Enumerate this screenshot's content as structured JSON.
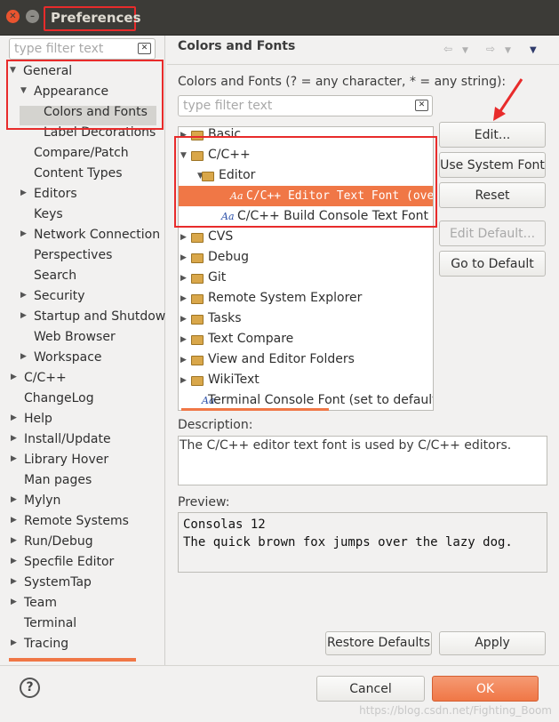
{
  "window": {
    "title": "Preferences",
    "close_glyph": "✕",
    "min_glyph": "–"
  },
  "left": {
    "filter_placeholder": "type filter text",
    "tree": [
      {
        "label": "General",
        "expanded": true
      },
      {
        "label": "Appearance",
        "expanded": true
      },
      {
        "label": "Colors and Fonts",
        "selected": true
      },
      {
        "label": "Label Decorations"
      },
      {
        "label": "Compare/Patch"
      },
      {
        "label": "Content Types"
      },
      {
        "label": "Editors",
        "expandable": true
      },
      {
        "label": "Keys"
      },
      {
        "label": "Network Connection",
        "expandable": true
      },
      {
        "label": "Perspectives"
      },
      {
        "label": "Search"
      },
      {
        "label": "Security",
        "expandable": true
      },
      {
        "label": "Startup and Shutdow",
        "expandable": true
      },
      {
        "label": "Web Browser"
      },
      {
        "label": "Workspace",
        "expandable": true
      },
      {
        "label": "C/C++",
        "expandable": true
      },
      {
        "label": "ChangeLog"
      },
      {
        "label": "Help",
        "expandable": true
      },
      {
        "label": "Install/Update",
        "expandable": true
      },
      {
        "label": "Library Hover",
        "expandable": true
      },
      {
        "label": "Man pages"
      },
      {
        "label": "Mylyn",
        "expandable": true
      },
      {
        "label": "Remote Systems",
        "expandable": true
      },
      {
        "label": "Run/Debug",
        "expandable": true
      },
      {
        "label": "Specfile Editor",
        "expandable": true
      },
      {
        "label": "SystemTap",
        "expandable": true
      },
      {
        "label": "Team",
        "expandable": true
      },
      {
        "label": "Terminal"
      },
      {
        "label": "Tracing",
        "expandable": true
      }
    ]
  },
  "right": {
    "title": "Colors and Fonts",
    "instructions": "Colors and Fonts (? = any character, * = any string):",
    "filter_placeholder": "type filter text",
    "tree": [
      {
        "label": "Basic",
        "kind": "folder"
      },
      {
        "label": "C/C++",
        "kind": "folder",
        "expanded": true
      },
      {
        "label": "Editor",
        "kind": "folder",
        "expanded": true
      },
      {
        "label": "C/C++ Editor Text Font (overr",
        "kind": "font",
        "selected": true
      },
      {
        "label": "C/C++ Build Console Text Font (set to",
        "kind": "font"
      },
      {
        "label": "CVS",
        "kind": "folder"
      },
      {
        "label": "Debug",
        "kind": "folder"
      },
      {
        "label": "Git",
        "kind": "folder"
      },
      {
        "label": "Remote System Explorer",
        "kind": "folder"
      },
      {
        "label": "Tasks",
        "kind": "folder"
      },
      {
        "label": "Text Compare",
        "kind": "folder"
      },
      {
        "label": "View and Editor Folders",
        "kind": "folder"
      },
      {
        "label": "WikiText",
        "kind": "folder"
      },
      {
        "label": "Terminal Console Font (set to default:",
        "kind": "font"
      }
    ],
    "buttons": {
      "edit": "Edit...",
      "use_system_font": "Use System Font",
      "reset": "Reset",
      "edit_default": "Edit Default...",
      "go_to_default": "Go to Default"
    },
    "description_label": "Description:",
    "description_text": "The C/C++ editor text font is used by C/C++ editors.",
    "preview_label": "Preview:",
    "preview_lines": [
      "Consolas 12",
      "The quick brown fox jumps over the lazy dog."
    ],
    "restore_defaults": "Restore Defaults",
    "apply": "Apply"
  },
  "footer": {
    "help_glyph": "?",
    "cancel": "Cancel",
    "ok": "OK",
    "watermark": "https://blog.csdn.net/Fighting_Boom"
  },
  "colors": {
    "accent": "#f07746",
    "annotation_red": "#e82b2b",
    "titlebar": "#3c3b37"
  },
  "icon_glyphs": {
    "font": "Aa",
    "expanded": "▼",
    "collapsed": "▶",
    "clear": "✕"
  }
}
